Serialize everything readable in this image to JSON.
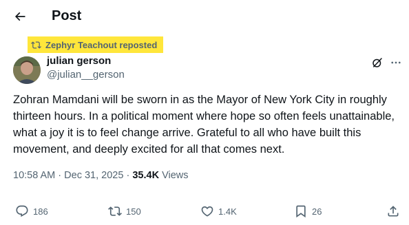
{
  "header": {
    "title": "Post",
    "back_icon": "arrow-left-icon"
  },
  "repost": {
    "icon": "repost-icon",
    "label": "Zephyr Teachout reposted",
    "highlight_color": "#ffe63b"
  },
  "author": {
    "display_name": "julian gerson",
    "handle": "@julian__gerson"
  },
  "tweet": {
    "text": "Zohran Mamdani will be sworn in as the Mayor of New York City in roughly thirteen hours. In a political moment where hope so often feels unattainable, what a joy it is to feel change arrive. Grateful to all who have built this movement, and deeply excited for all that comes next."
  },
  "meta": {
    "time": "10:58 AM",
    "separator": "·",
    "date": "Dec 31, 2025",
    "views_count": "35.4K",
    "views_label": "Views"
  },
  "actions": {
    "replies": "186",
    "reposts": "150",
    "likes": "1.4K",
    "bookmarks": "26"
  },
  "colors": {
    "text_primary": "#0f1419",
    "text_secondary": "#536471"
  }
}
